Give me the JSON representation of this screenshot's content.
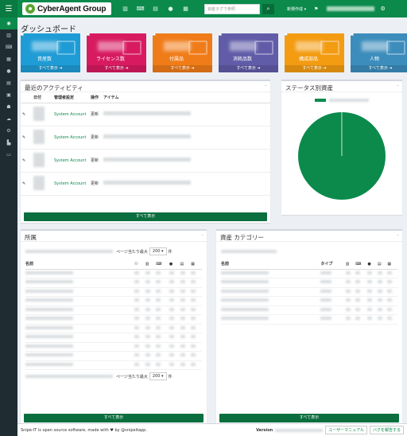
{
  "topbar": {
    "brand": "CyberAgent Group",
    "search_placeholder": "資産タグで参照",
    "create_label": "新規作成 ▾",
    "nav_icons": [
      "barcode-icon",
      "keyboard-icon",
      "hdd-icon",
      "tint-icon",
      "server-icon"
    ]
  },
  "sidebar": {
    "items": [
      "dashboard-icon",
      "barcode-icon",
      "keyboard-icon",
      "server-icon",
      "tint-icon",
      "hdd-icon",
      "image-icon",
      "users-icon",
      "cloud-icon",
      "settings-icon",
      "chart-icon",
      "laptop-icon"
    ]
  },
  "page": {
    "title": "ダッシュボード"
  },
  "tiles": [
    {
      "label": "資産数",
      "footer": "すべて表示 ➜",
      "color": "#1f9cd6"
    },
    {
      "label": "ライセンス数",
      "footer": "すべて表示 ➜",
      "color": "#d81b60"
    },
    {
      "label": "付属品",
      "footer": "すべて表示 ➜",
      "color": "#f07c19"
    },
    {
      "label": "消耗品数",
      "footer": "すべて表示 ➜",
      "color": "#605ca8"
    },
    {
      "label": "構成部品",
      "footer": "すべて表示 ➜",
      "color": "#f39c12"
    },
    {
      "label": "人物",
      "footer": "すべて表示 ➜",
      "color": "#3c8dbc"
    }
  ],
  "activity": {
    "title": "最近のアクティビティ",
    "columns": [
      "日付",
      "管理者設定",
      "操作",
      "アイテム"
    ],
    "rows": [
      {
        "admin": "System Account",
        "action": "更新"
      },
      {
        "admin": "System Account",
        "action": "更新"
      },
      {
        "admin": "System Account",
        "action": "更新"
      },
      {
        "admin": "System Account",
        "action": "更新"
      }
    ],
    "view_all": "すべて表示"
  },
  "status": {
    "title": "ステータス別資産"
  },
  "chart_data": {
    "type": "pie",
    "title": "ステータス別資産",
    "categories": [
      ""
    ],
    "values": [
      100
    ],
    "colors": [
      "#0b8a4c"
    ]
  },
  "locations": {
    "title": "所属",
    "per_page_label": "ページ当たり最大",
    "per_page_value": "200 ▾",
    "per_page_suffix": "件",
    "columns": [
      "名前"
    ],
    "view_all": "すべて表示"
  },
  "categories": {
    "title": "資産 カテゴリー",
    "columns": [
      "名前",
      "タイプ"
    ],
    "view_all": "すべて表示"
  },
  "footer": {
    "text_prefix": "Snipe-IT is open source software, made with ♥ by @snipeitapp.",
    "version_label": "Version",
    "manual": "ユーザーマニュアル",
    "report": "バグを報告する"
  }
}
